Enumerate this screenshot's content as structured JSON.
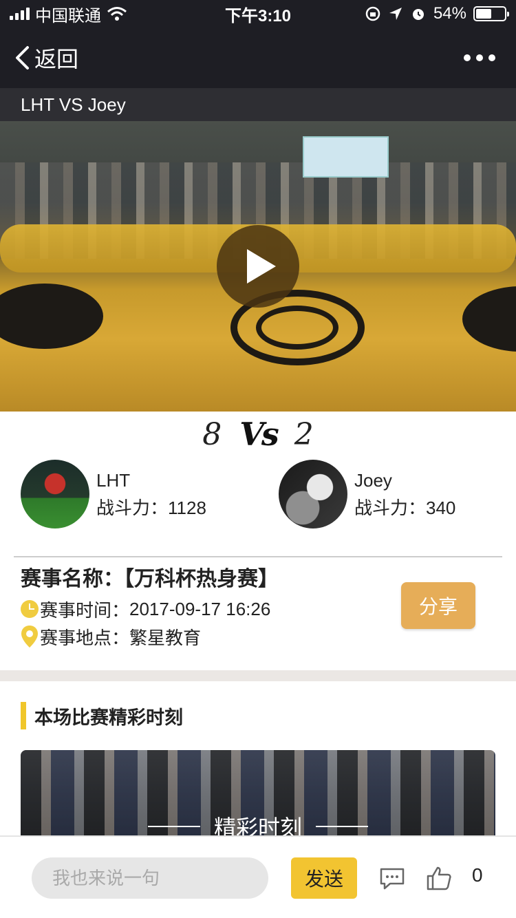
{
  "status_bar": {
    "carrier": "中国联通",
    "time": "下午3:10",
    "battery_percent": "54%",
    "battery_level": 0.54,
    "icons": [
      "signal-icon",
      "wifi-icon",
      "orientation-lock-icon",
      "location-icon",
      "alarm-icon",
      "battery-icon"
    ]
  },
  "nav": {
    "back_label": "返回",
    "more_icon": "more-icon"
  },
  "match_title": "LHT VS Joey",
  "video": {
    "play_icon": "play-icon"
  },
  "score": {
    "home": "8",
    "vs": "Vs",
    "away": "2"
  },
  "teams": [
    {
      "name": "LHT",
      "power_label": "战斗力：",
      "power_value": "1128"
    },
    {
      "name": "Joey",
      "power_label": "战斗力：",
      "power_value": "340"
    }
  ],
  "match_info": {
    "name_label": "赛事名称：",
    "name_value": "【万科杯热身赛】",
    "time_label": "赛事时间：",
    "time_value": "2017-09-17 16:26",
    "place_label": "赛事地点：",
    "place_value": "繁星教育",
    "share_label": "分享"
  },
  "highlights": {
    "section_title": "本场比赛精彩时刻",
    "card_title": "精彩时刻"
  },
  "bottom_bar": {
    "comment_placeholder": "我也来说一句",
    "send_label": "发送",
    "like_count": "0"
  },
  "colors": {
    "header_bg": "#1e1e24",
    "title_bar_bg": "#2e2e33",
    "accent_yellow": "#f2c431",
    "share_orange": "#e6ad58"
  }
}
